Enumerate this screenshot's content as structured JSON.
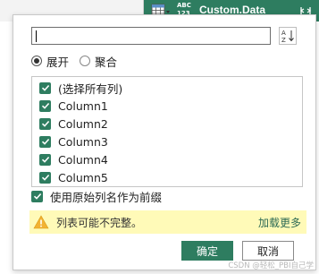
{
  "column_header": {
    "type_badge_line1": "ABC",
    "type_badge_line2": "123",
    "name": "Custom.Data",
    "accent_color": "#2e7d60"
  },
  "filter_panel": {
    "search": {
      "value": "",
      "placeholder": ""
    },
    "sort_icon": "sort-az-icon",
    "mode_options": [
      {
        "label": "展开",
        "selected": true
      },
      {
        "label": "聚合",
        "selected": false
      }
    ],
    "columns": [
      {
        "label": "(选择所有列)",
        "checked": true
      },
      {
        "label": "Column1",
        "checked": true
      },
      {
        "label": "Column2",
        "checked": true
      },
      {
        "label": "Column3",
        "checked": true
      },
      {
        "label": "Column4",
        "checked": true
      },
      {
        "label": "Column5",
        "checked": true
      }
    ],
    "use_prefix": {
      "label": "使用原始列名作为前缀",
      "checked": true
    },
    "warning": {
      "text": "列表可能不完整。",
      "action": "加载更多",
      "icon": "warning-icon"
    },
    "ok_label": "确定",
    "cancel_label": "取消"
  },
  "watermark": "CSDN @轻松_PBI自己学"
}
